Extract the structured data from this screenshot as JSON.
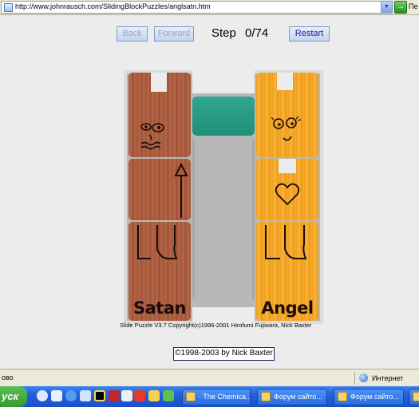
{
  "browser": {
    "url": "http://www.johnrausch.com/SlidingBlockPuzzles/anglsatn.htm",
    "go_label": "Пе",
    "status_text": "ово",
    "zone_label": "Интернет"
  },
  "puzzle": {
    "back_label": "Back",
    "forward_label": "Forward",
    "step_label": "Step",
    "step_value": "0/74",
    "restart_label": "Restart",
    "satan_label": "Satan",
    "angel_label": "Angel",
    "satan_color": "#a8593c",
    "angel_color": "#f2a424",
    "teal_color": "#26998a"
  },
  "footer": {
    "copyright": "Slide Puzzle V3.7  Copyright(c)1996-2001 Hirofumi Fujiwara, Nick Baxter",
    "credit": "©1998-2003 by Nick Baxter"
  },
  "taskbar": {
    "start_label": "уск",
    "tasks": [
      {
        "label": "· The Chemica..."
      },
      {
        "label": "Форум сайто..."
      },
      {
        "label": "Форум сайто..."
      },
      {
        "label": ""
      }
    ]
  }
}
